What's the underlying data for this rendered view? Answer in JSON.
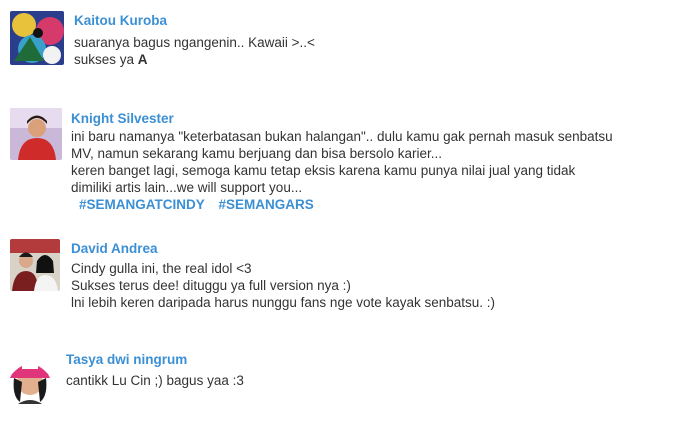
{
  "comments": [
    {
      "author": "Kaitou Kuroba",
      "avatar_icon": "colorful-art-avatar",
      "lines": [
        "suaranya bagus ngangenin.. Kawaii >..<",
        "sukses ya "
      ],
      "bold_suffix": "A"
    },
    {
      "author": "Knight Silvester",
      "avatar_icon": "person-red-shirt-avatar",
      "lines": [
        "ini baru namanya \"keterbatasan bukan halangan\".. dulu kamu gak pernah masuk senbatsu",
        "MV, namun sekarang kamu berjuang dan bisa bersolo karier...",
        "keren banget lagi, semoga kamu tetap eksis karena kamu punya nilai jual yang tidak",
        "dimiliki artis lain...we will support you..."
      ],
      "hashtags": [
        "#SEMANGATCINDY",
        "#SEMANGARS"
      ]
    },
    {
      "author": "David Andrea",
      "avatar_icon": "two-people-photo-avatar",
      "lines": [
        "Cindy gulla ini, the real idol <3",
        "Sukses terus dee! dituggu ya full version nya :)",
        "lni lebih keren daripada harus nunggu fans nge vote kayak senbatsu. :)"
      ]
    },
    {
      "author": "Tasya dwi ningrum",
      "avatar_icon": "girl-pink-cap-avatar",
      "lines": [
        "cantikk Lu Cin ;) bagus yaa :3"
      ]
    }
  ]
}
